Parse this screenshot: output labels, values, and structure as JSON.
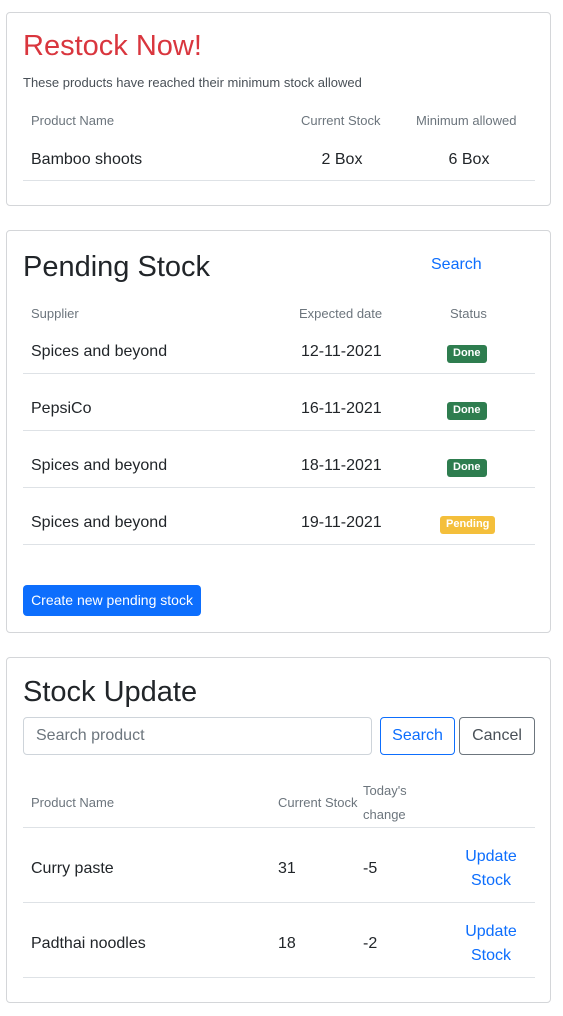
{
  "restock": {
    "title": "Restock Now!",
    "subtitle": "These products have reached their minimum stock allowed",
    "columns": [
      "Product Name",
      "Current Stock",
      "Minimum allowed"
    ],
    "rows": [
      {
        "product": "Bamboo shoots",
        "current": "2 Box",
        "minimum": "6 Box"
      }
    ]
  },
  "pending": {
    "title": "Pending Stock",
    "search_link": "Search",
    "columns": [
      "Supplier",
      "Expected date",
      "Status"
    ],
    "rows": [
      {
        "supplier": "Spices and beyond",
        "date": "12-11-2021",
        "status": "Done"
      },
      {
        "supplier": "PepsiCo",
        "date": "16-11-2021",
        "status": "Done"
      },
      {
        "supplier": "Spices and beyond",
        "date": "18-11-2021",
        "status": "Done"
      },
      {
        "supplier": "Spices and beyond",
        "date": "19-11-2021",
        "status": "Pending"
      }
    ],
    "create_button": "Create new pending stock"
  },
  "stock_update": {
    "title": "Stock Update",
    "search_placeholder": "Search product",
    "search_button": "Search",
    "cancel_button": "Cancel",
    "columns": [
      "Product Name",
      "Current Stock",
      "Today's change"
    ],
    "rows": [
      {
        "product": "Curry paste",
        "current": "31",
        "change": "-5",
        "action": "Update Stock"
      },
      {
        "product": "Padthai noodles",
        "current": "18",
        "change": "-2",
        "action": "Update Stock"
      }
    ]
  },
  "colors": {
    "primary": "#0d6efd",
    "danger_title": "#d9363e",
    "badge_done": "#2e7d4f",
    "badge_pending": "#f4bf3b"
  }
}
